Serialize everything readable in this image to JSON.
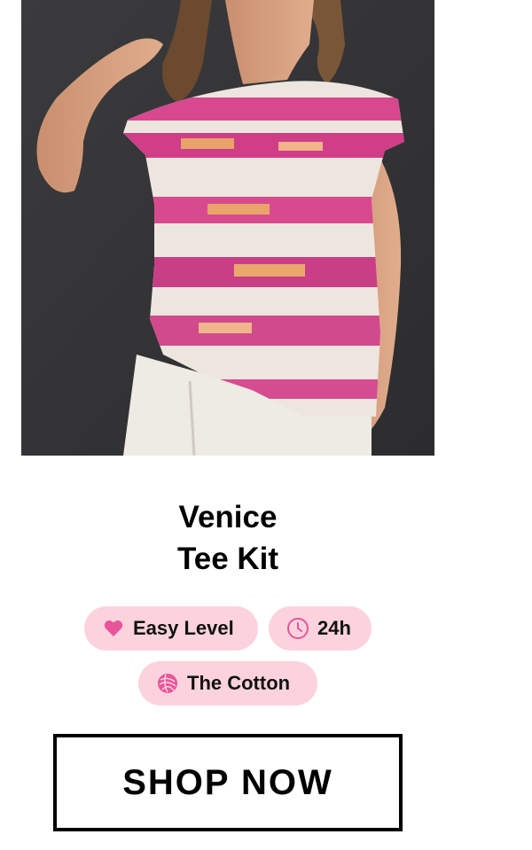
{
  "product": {
    "title_line1": "Venice",
    "title_line2": "Tee Kit"
  },
  "badges": {
    "level": {
      "label": "Easy Level",
      "icon": "heart-icon"
    },
    "time": {
      "label": "24h",
      "icon": "clock-icon"
    },
    "yarn": {
      "label": "The Cotton",
      "icon": "yarn-ball-icon"
    }
  },
  "cta": {
    "label": "SHOP NOW"
  },
  "colors": {
    "badge_bg": "#fcd3dd",
    "accent_pink": "#e8559a",
    "text": "#000000"
  }
}
